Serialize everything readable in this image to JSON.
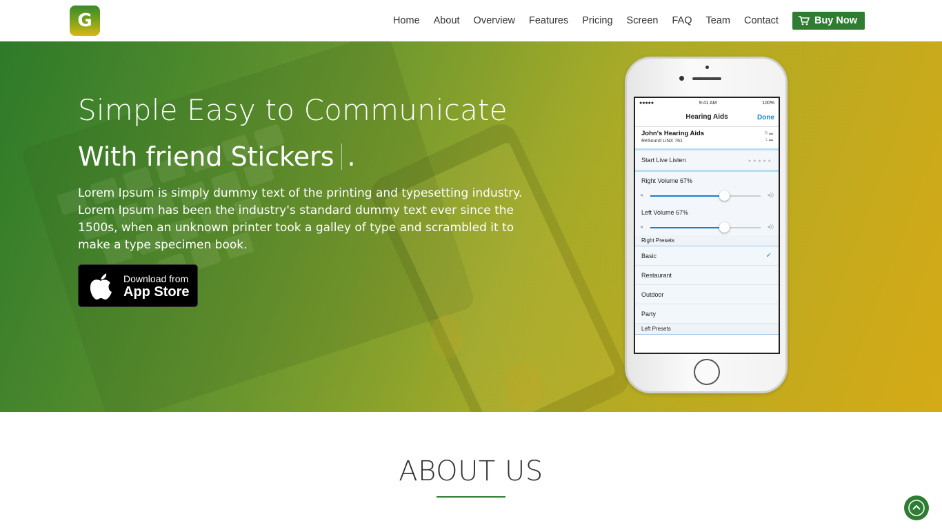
{
  "brand": {
    "logo_letter": "G"
  },
  "nav": {
    "items": [
      "Home",
      "About",
      "Overview",
      "Features",
      "Pricing",
      "Screen",
      "FAQ",
      "Team",
      "Contact"
    ],
    "buy_label": "Buy Now"
  },
  "hero": {
    "title": "Simple Easy to Communicate",
    "subtitle": "With friend Stickers",
    "subtitle_tail": ".",
    "description": "Lorem Ipsum is simply dummy text of the printing and typesetting industry. Lorem Ipsum has been the industry's standard dummy text ever since the 1500s, when an unknown printer took a galley of type and scrambled it to make a type specimen book.",
    "appstore": {
      "small": "Download from",
      "big": "App Store"
    }
  },
  "phone": {
    "time": "9:41 AM",
    "battery": "100%",
    "screen_title": "Hearing Aids",
    "done": "Done",
    "device_name": "John's Hearing Aids",
    "device_model": "ReSound LiNX 761",
    "battery_r": "R",
    "battery_l": "L",
    "live_listen": "Start Live Listen",
    "right_volume": "Right Volume  67%",
    "left_volume": "Left Volume  67%",
    "right_volume_level": 0.67,
    "left_volume_level": 0.67,
    "right_presets": "Right Presets",
    "presets": [
      "Basic",
      "Restaurant",
      "Outdoor",
      "Party"
    ],
    "left_presets": "Left Presets"
  },
  "about": {
    "title": "ABOUT US"
  },
  "colors": {
    "accent": "#2e7d32",
    "hero_left": "#2f7a2c",
    "hero_right": "#d1ab1b"
  }
}
